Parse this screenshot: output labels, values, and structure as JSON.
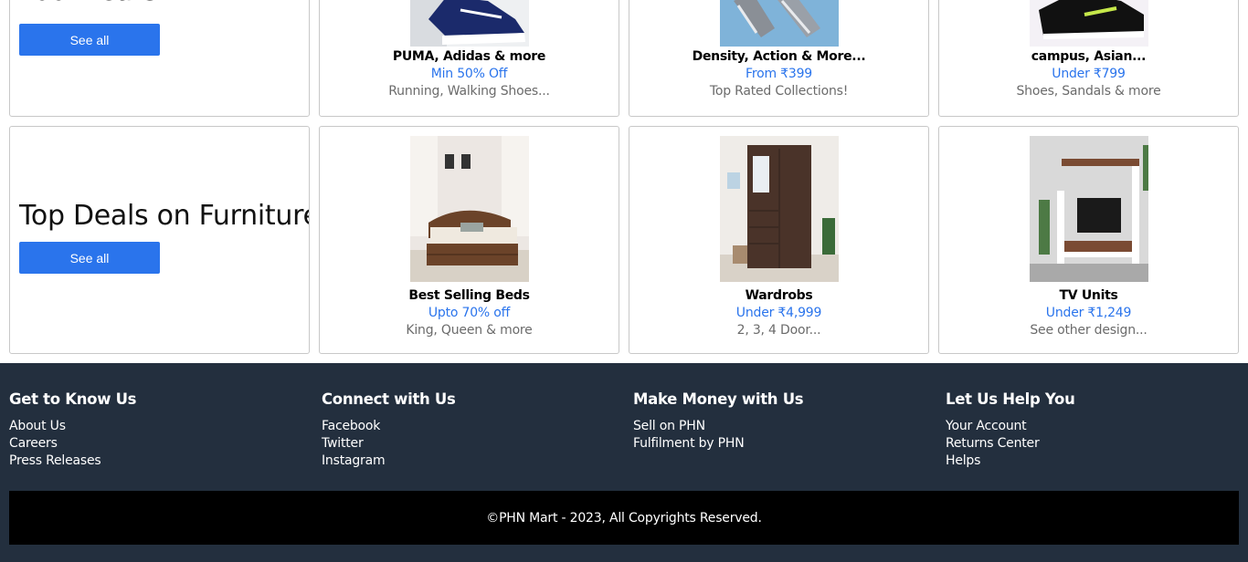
{
  "sections": [
    {
      "heading": "Footwears",
      "see_all": "See all",
      "products": [
        {
          "name": "PUMA, Adidas & more",
          "offer": "Min 50% Off",
          "sub": "Running, Walking Shoes...",
          "icon": "shoe-image"
        },
        {
          "name": "Density, Action & More...",
          "offer": "From ₹399",
          "sub": "Top Rated Collections!",
          "icon": "shoe-image"
        },
        {
          "name": "campus, Asian...",
          "offer": "Under ₹799",
          "sub": "Shoes, Sandals & more",
          "icon": "shoe-image"
        }
      ]
    },
    {
      "heading": "Top Deals on Furnitures",
      "see_all": "See all",
      "products": [
        {
          "name": "Best Selling Beds",
          "offer": "Upto 70% off",
          "sub": "King, Queen & more",
          "icon": "bed-image"
        },
        {
          "name": "Wardrobs",
          "offer": "Under ₹4,999",
          "sub": "2, 3, 4 Door...",
          "icon": "wardrobe-image"
        },
        {
          "name": "TV Units",
          "offer": "Under ₹1,249",
          "sub": "See other design...",
          "icon": "tv-unit-image"
        }
      ]
    }
  ],
  "footer": {
    "columns": [
      {
        "title": "Get to Know Us",
        "links": [
          "About Us",
          "Careers",
          "Press Releases"
        ]
      },
      {
        "title": "Connect with Us",
        "links": [
          "Facebook",
          "Twitter",
          "Instagram"
        ]
      },
      {
        "title": "Make Money with Us",
        "links": [
          "Sell on PHN",
          "Fulfilment by PHN"
        ]
      },
      {
        "title": "Let Us Help You",
        "links": [
          "Your Account",
          "Returns Center",
          "Helps"
        ]
      }
    ],
    "copyright": "©PHN Mart - 2023, All Copyrights Reserved."
  },
  "colors": {
    "accent": "#2a74ec",
    "footer_bg": "#232f3e",
    "copyright_bg": "#000000"
  }
}
